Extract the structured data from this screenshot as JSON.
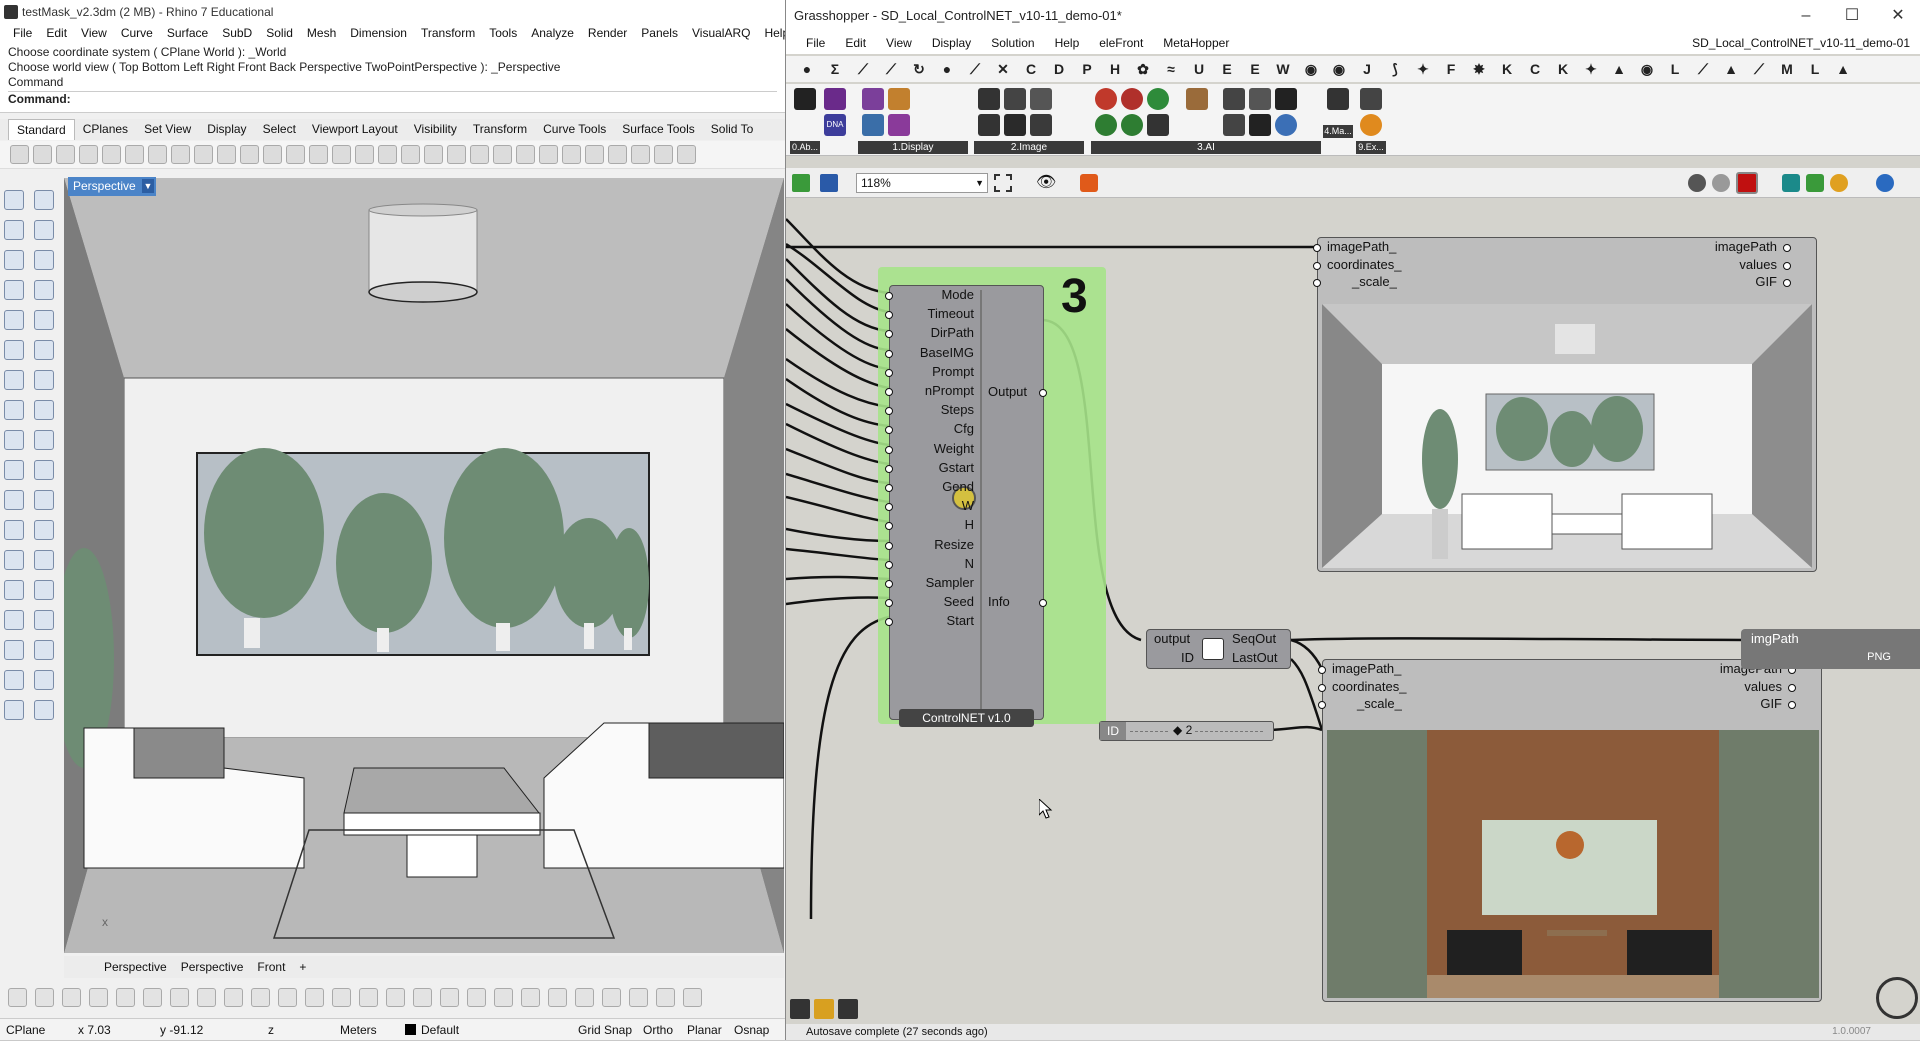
{
  "rhino": {
    "title": "testMask_v2.3dm (2 MB) - Rhino 7 Educational",
    "menu": [
      "File",
      "Edit",
      "View",
      "Curve",
      "Surface",
      "SubD",
      "Solid",
      "Mesh",
      "Dimension",
      "Transform",
      "Tools",
      "Analyze",
      "Render",
      "Panels",
      "VisualARQ",
      "Help"
    ],
    "command_history": [
      "Choose coordinate system ( CPlane  World ): _World",
      "Choose world view ( Top  Bottom  Left  Right  Front  Back  Perspective  TwoPointPerspective ): _Perspective",
      "Command"
    ],
    "command_prompt": "Command:",
    "toolbar_tabs": [
      "Standard",
      "CPlanes",
      "Set View",
      "Display",
      "Select",
      "Viewport Layout",
      "Visibility",
      "Transform",
      "Curve Tools",
      "Surface Tools",
      "Solid To"
    ],
    "active_tab": "Standard",
    "viewport_name": "Perspective",
    "viewport_tabs": [
      "Perspective",
      "Perspective",
      "Front"
    ],
    "axis_label": "x",
    "status": {
      "cplane": "CPlane",
      "x": "x 7.03",
      "y": "y -91.12",
      "z": "z",
      "units": "Meters",
      "layer": "Default",
      "grid_snap": "Grid Snap",
      "ortho": "Ortho",
      "planar": "Planar",
      "osnap": "Osnap"
    }
  },
  "gh": {
    "title": "Grasshopper - SD_Local_ControlNET_v10-11_demo-01*",
    "doc_name": "SD_Local_ControlNET_v10-11_demo-01",
    "menu": [
      "File",
      "Edit",
      "View",
      "Display",
      "Solution",
      "Help",
      "eleFront",
      "MetaHopper"
    ],
    "category_tabs": [
      "●",
      "Σ",
      "⟋",
      "⟋",
      "↻",
      "●",
      "⟋",
      "✕",
      "C",
      "D",
      "P",
      "H",
      "✿",
      "≈",
      "U",
      "E",
      "E",
      "W",
      "◉",
      "◉",
      "J",
      "⟆",
      "✦",
      "F",
      "✸",
      "K",
      "C",
      "K",
      "✦",
      "▲",
      "◉",
      "L",
      "⟋",
      "▲",
      "⟋",
      "M",
      "L",
      "▲"
    ],
    "ribbon_groups": [
      "1.Display",
      "2.Image",
      "3.AI",
      "9.Ex..."
    ],
    "ribbon_small_labels": [
      "0.Ab...",
      "DNA",
      "4.Ma...",
      "9.Ex..."
    ],
    "zoom": "118%",
    "controlnet": {
      "group_number": "3",
      "inputs": [
        "Mode",
        "Timeout",
        "DirPath",
        "BaseIMG",
        "Prompt",
        "nPrompt",
        "Steps",
        "Cfg",
        "Weight",
        "Gstart",
        "Gend",
        "W",
        "H",
        "Resize",
        "N",
        "Sampler",
        "Seed",
        "Start"
      ],
      "outputs": [
        "Output",
        "Info"
      ],
      "caption": "ControlNET v1.0"
    },
    "viewer_top": {
      "inputs": [
        "imagePath_",
        "coordinates_",
        "_scale_"
      ],
      "outputs": [
        "imagePath",
        "values",
        "GIF"
      ]
    },
    "viewer_bottom": {
      "inputs": [
        "imagePath_",
        "coordinates_",
        "_scale_"
      ],
      "outputs": [
        "imagePath",
        "values",
        "GIF"
      ]
    },
    "seq": {
      "inputs": [
        "output",
        "ID"
      ],
      "outputs": [
        "SeqOut",
        "LastOut"
      ]
    },
    "id_slider": {
      "label": "ID",
      "value": "◆ 2"
    },
    "img_out": {
      "label": "imgPath",
      "sub": "PNG"
    },
    "status": "Autosave complete (27 seconds ago)",
    "version": "1.0.0007"
  }
}
